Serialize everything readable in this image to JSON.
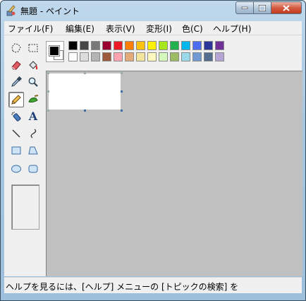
{
  "window": {
    "title": "無題 - ペイント"
  },
  "menu": [
    {
      "label": "ファイル(F)"
    },
    {
      "label": "編集(E)"
    },
    {
      "label": "表示(V)"
    },
    {
      "label": "変形(I)"
    },
    {
      "label": "色(C)"
    },
    {
      "label": "ヘルプ(H)"
    }
  ],
  "tools": [
    {
      "name": "free-form-select"
    },
    {
      "name": "rectangle-select"
    },
    {
      "name": "eraser"
    },
    {
      "name": "fill"
    },
    {
      "name": "pick-color"
    },
    {
      "name": "magnifier"
    },
    {
      "name": "pencil",
      "selected": true
    },
    {
      "name": "brush"
    },
    {
      "name": "airbrush"
    },
    {
      "name": "text",
      "glyph": "A"
    },
    {
      "name": "line"
    },
    {
      "name": "curve"
    },
    {
      "name": "rectangle"
    },
    {
      "name": "polygon"
    },
    {
      "name": "ellipse"
    },
    {
      "name": "rounded-rectangle"
    }
  ],
  "colors": {
    "foreground": "#000000",
    "background": "#ffffff",
    "palette_row1": [
      "#000000",
      "#464646",
      "#787878",
      "#990030",
      "#ed1c24",
      "#ff7e00",
      "#ffc20e",
      "#fff200",
      "#a8e61d",
      "#22b14c",
      "#00b7ef",
      "#4d6df3",
      "#2f3699",
      "#6f3198"
    ],
    "palette_row2": [
      "#ffffff",
      "#dcdcdc",
      "#b4b4b4",
      "#9c5a3c",
      "#ffa3b1",
      "#e5aa7a",
      "#f5e49c",
      "#fff9bd",
      "#d3f9bc",
      "#9dbb61",
      "#99d9ea",
      "#709ad1",
      "#546d8e",
      "#b5a5d5"
    ]
  },
  "status": {
    "text": "ヘルプを見るには、[ヘルプ] メニューの [トピックの検索] を"
  }
}
